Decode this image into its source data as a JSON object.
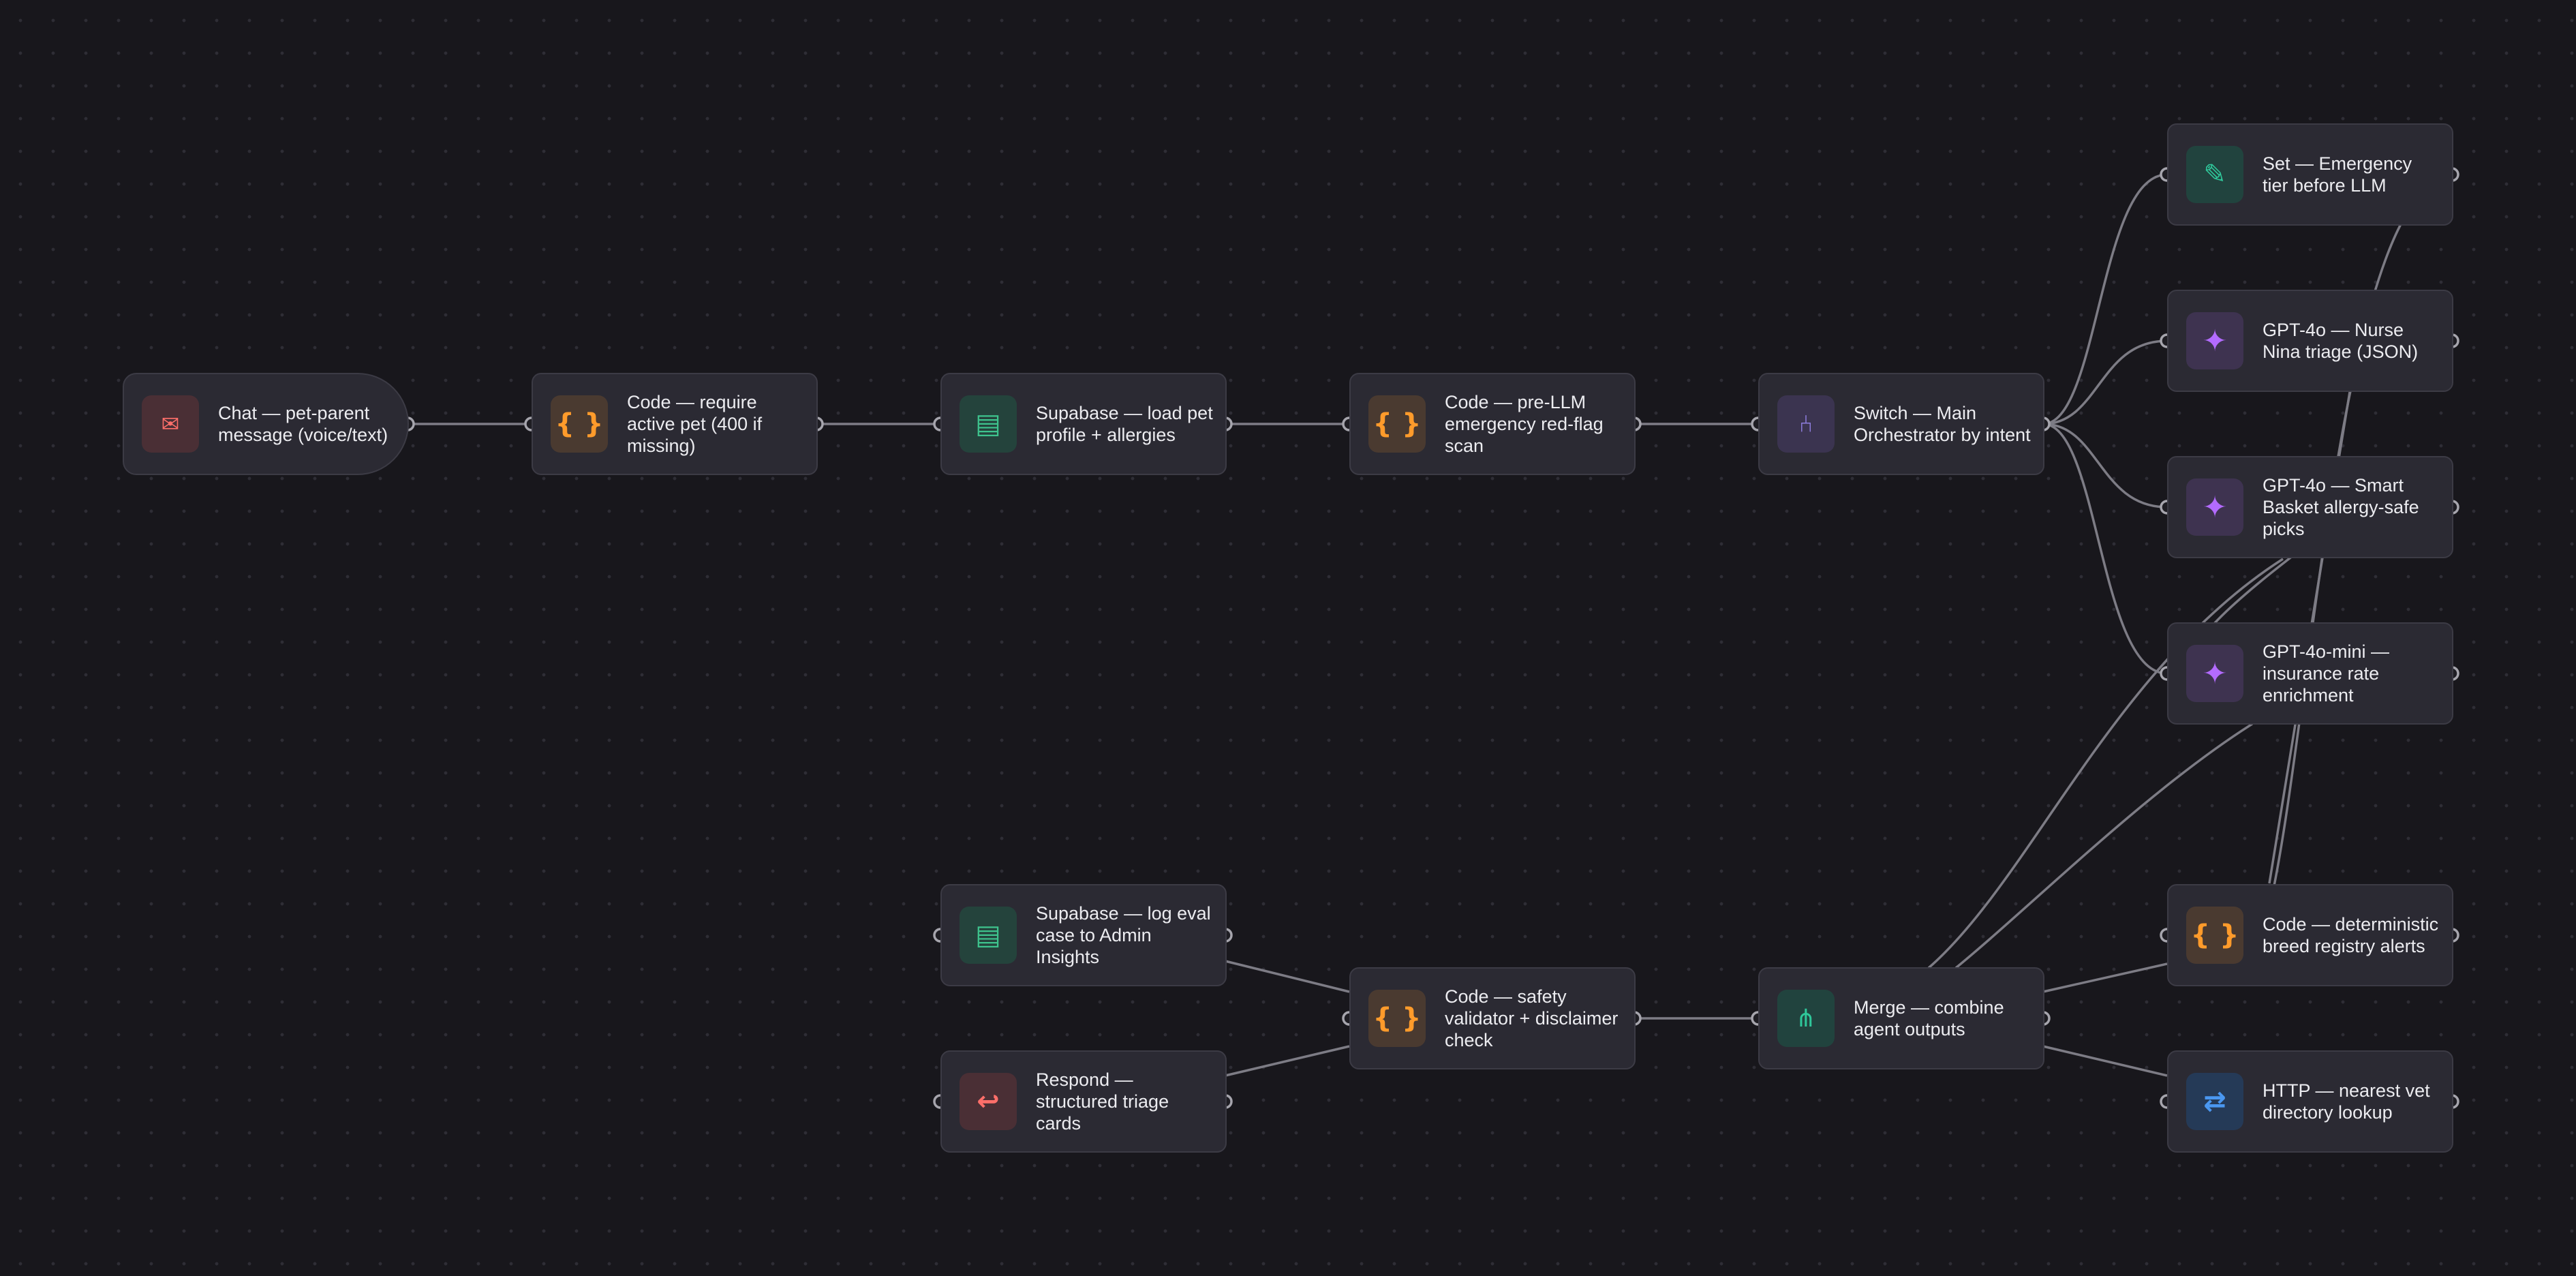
{
  "canvas": {
    "background": "#18171c",
    "edge_color": "#8b8a92"
  },
  "nodes": {
    "chat": {
      "label": "Chat — pet-parent message (voice/text)",
      "icon": "envelope-icon",
      "glyph": "✉"
    },
    "require_pet": {
      "label": "Code — require active pet (400 if missing)",
      "icon": "code-braces-icon",
      "glyph": "{ }"
    },
    "load_profile": {
      "label": "Supabase — load pet profile + allergies",
      "icon": "database-table-icon",
      "glyph": "▤"
    },
    "red_flag": {
      "label": "Code — pre-LLM emergency red-flag scan",
      "icon": "code-braces-icon",
      "glyph": "{ }"
    },
    "switch": {
      "label": "Switch — Main Orchestrator by intent",
      "icon": "fork-icon",
      "glyph": "⑃"
    },
    "set_tier": {
      "label": "Set — Emergency tier before LLM",
      "icon": "pencil-icon",
      "glyph": "✎"
    },
    "gpt_nurse": {
      "label": "GPT-4o — Nurse Nina triage (JSON)",
      "icon": "sparkle-icon",
      "glyph": "✦"
    },
    "gpt_basket": {
      "label": "GPT-4o — Smart Basket allergy-safe picks",
      "icon": "sparkle-icon",
      "glyph": "✦"
    },
    "gpt_mini": {
      "label": "GPT-4o-mini — insurance rate enrichment",
      "icon": "sparkle-icon",
      "glyph": "✦"
    },
    "log_eval": {
      "label": "Supabase — log eval case to Admin Insights",
      "icon": "database-table-icon",
      "glyph": "▤"
    },
    "respond": {
      "label": "Respond — structured triage cards",
      "icon": "return-arrow-icon",
      "glyph": "↩"
    },
    "validator": {
      "label": "Code — safety validator + disclaimer check",
      "icon": "code-braces-icon",
      "glyph": "{ }"
    },
    "merge": {
      "label": "Merge — combine agent outputs",
      "icon": "merge-icon",
      "glyph": "⋔"
    },
    "breed": {
      "label": "Code — deterministic breed registry alerts",
      "icon": "code-braces-icon",
      "glyph": "{ }"
    },
    "http_vet": {
      "label": "HTTP — nearest vet directory lookup",
      "icon": "swap-arrows-icon",
      "glyph": "⇄"
    }
  }
}
